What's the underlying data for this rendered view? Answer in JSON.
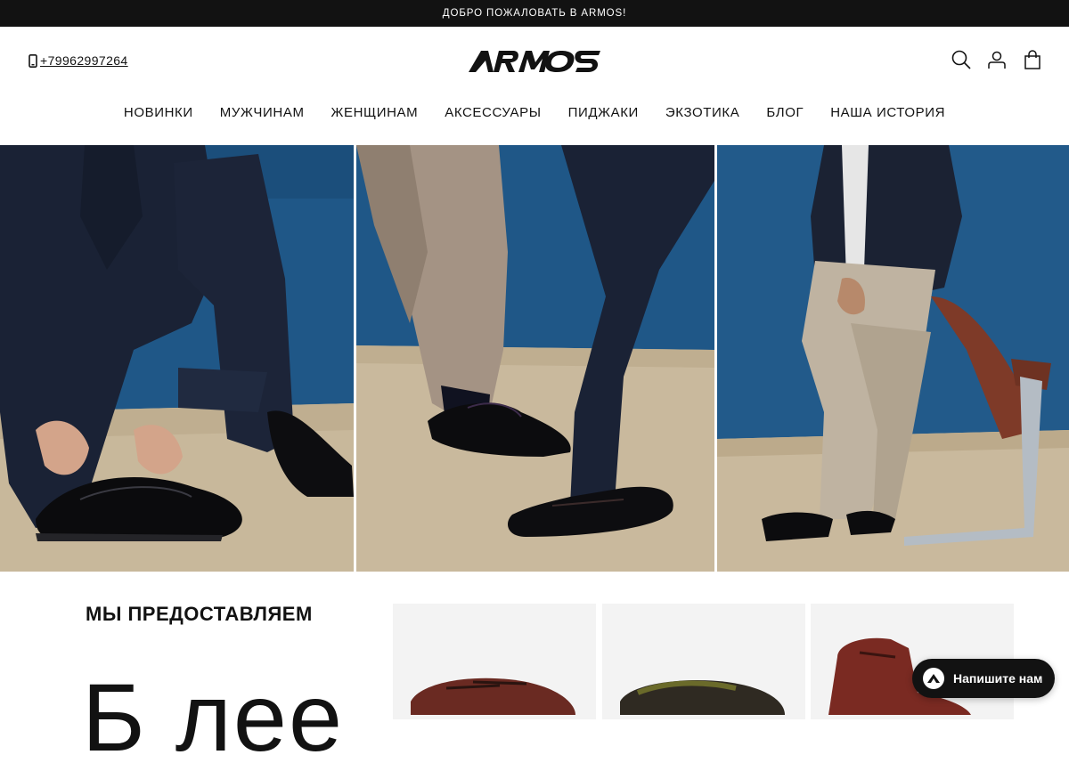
{
  "announcement": {
    "text": "ДОБРО ПОЖАЛОВАТЬ В ARMOS!"
  },
  "header": {
    "phone": "+79962997264",
    "logo_text": "ARMOS",
    "icons": [
      "search-icon",
      "account-icon",
      "cart-icon"
    ]
  },
  "nav": {
    "items": [
      {
        "label": "НОВИНКИ"
      },
      {
        "label": "МУЖЧИНАМ"
      },
      {
        "label": "ЖЕНЩИНАМ"
      },
      {
        "label": "АКСЕССУАРЫ"
      },
      {
        "label": "ПИДЖАКИ"
      },
      {
        "label": "ЭКЗОТИКА"
      },
      {
        "label": "БЛОГ"
      },
      {
        "label": "НАША ИСТОРИЯ"
      }
    ]
  },
  "section": {
    "title": "МЫ ПРЕДОСТАВЛЯЕМ",
    "big_text": "Б лее"
  },
  "chat": {
    "label": "Напишите нам"
  },
  "colors": {
    "announcement_bg": "#121212",
    "wall_blue": "#1f5787",
    "floor_sand": "#c8b89b",
    "chat_bg": "#121212"
  }
}
